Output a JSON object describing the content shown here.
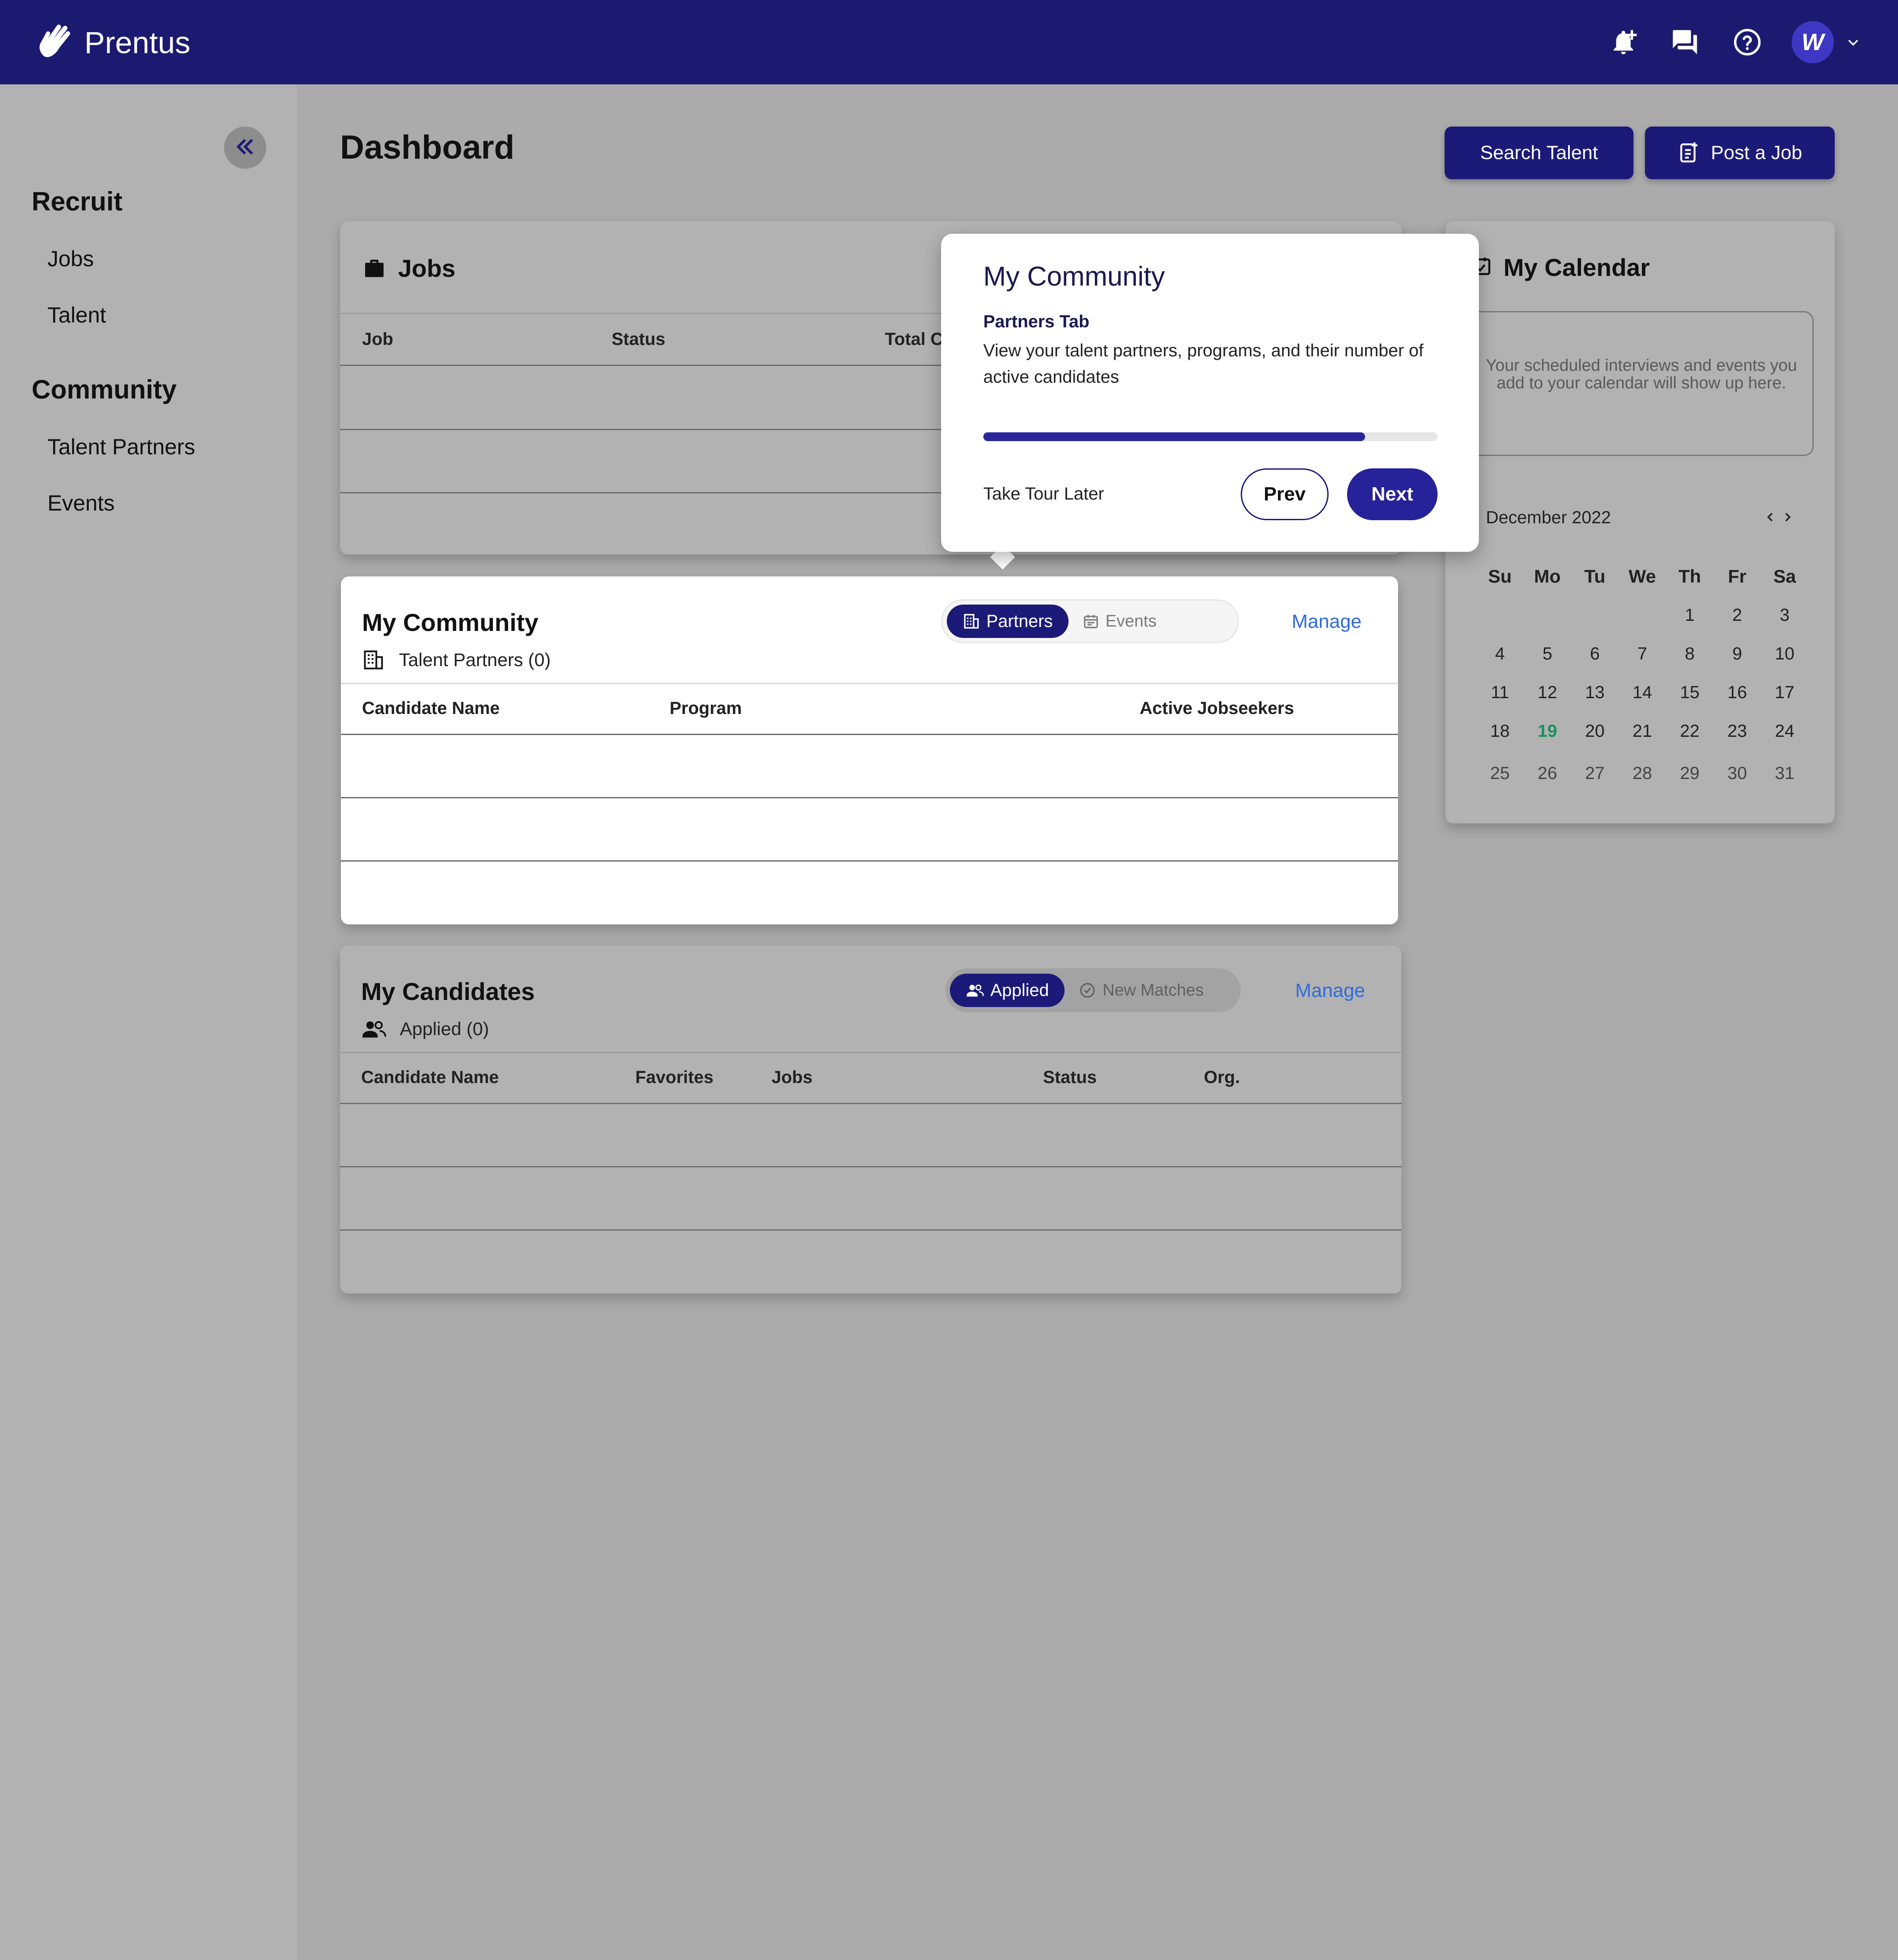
{
  "app": {
    "name": "Prentus",
    "logo_icon": "hand-wave-icon"
  },
  "header": {
    "icons": [
      "bell-plus-icon",
      "chat-icon",
      "help-icon"
    ],
    "avatar_letter": "W",
    "avatar_menu_icon": "chevron-down-icon"
  },
  "sidebar": {
    "collapse_icon": "double-chevron-left-icon",
    "sections": [
      {
        "title": "Recruit",
        "items": [
          "Jobs",
          "Talent"
        ]
      },
      {
        "title": "Community",
        "items": [
          "Talent Partners",
          "Events"
        ]
      }
    ]
  },
  "page": {
    "title": "Dashboard",
    "search_talent_label": "Search Talent",
    "post_job_label": "Post a Job"
  },
  "jobs_card": {
    "title": "Jobs",
    "columns": [
      "Job",
      "Status",
      "Total C"
    ]
  },
  "community_card": {
    "title": "My Community",
    "subtitle": "Talent Partners (0)",
    "tabs": {
      "active": "Partners",
      "inactive": "Events"
    },
    "manage_label": "Manage",
    "columns": [
      "Candidate Name",
      "Program",
      "Active Jobseekers"
    ]
  },
  "candidates_card": {
    "title": "My Candidates",
    "subtitle": "Applied (0)",
    "tabs": {
      "active": "Applied",
      "inactive": "New Matches"
    },
    "manage_label": "Manage",
    "columns": [
      "Candidate Name",
      "Favorites",
      "Jobs",
      "Status",
      "Org."
    ]
  },
  "calendar": {
    "title": "My Calendar",
    "empty_text": "Your scheduled interviews and events you add to your calendar will show up here.",
    "month": "December 2022",
    "weekdays": [
      "Su",
      "Mo",
      "Tu",
      "We",
      "Th",
      "Fr",
      "Sa"
    ],
    "today": "19",
    "weeks": [
      [
        "",
        "",
        "",
        "",
        "1",
        "2",
        "3"
      ],
      [
        "4",
        "5",
        "6",
        "7",
        "8",
        "9",
        "10"
      ],
      [
        "11",
        "12",
        "13",
        "14",
        "15",
        "16",
        "17"
      ],
      [
        "18",
        "19",
        "20",
        "21",
        "22",
        "23",
        "24"
      ],
      [
        "25",
        "26",
        "27",
        "28",
        "29",
        "30",
        "31"
      ]
    ]
  },
  "tour": {
    "title": "My Community",
    "subtitle": "Partners Tab",
    "description": "View your talent partners, programs, and their number of active candidates",
    "progress": 0.84,
    "later_label": "Take Tour Later",
    "prev_label": "Prev",
    "next_label": "Next"
  },
  "colors": {
    "header_bg": "#1b1a70",
    "primary": "#1c1a78",
    "link": "#2f6bdc",
    "today": "#17925f"
  }
}
